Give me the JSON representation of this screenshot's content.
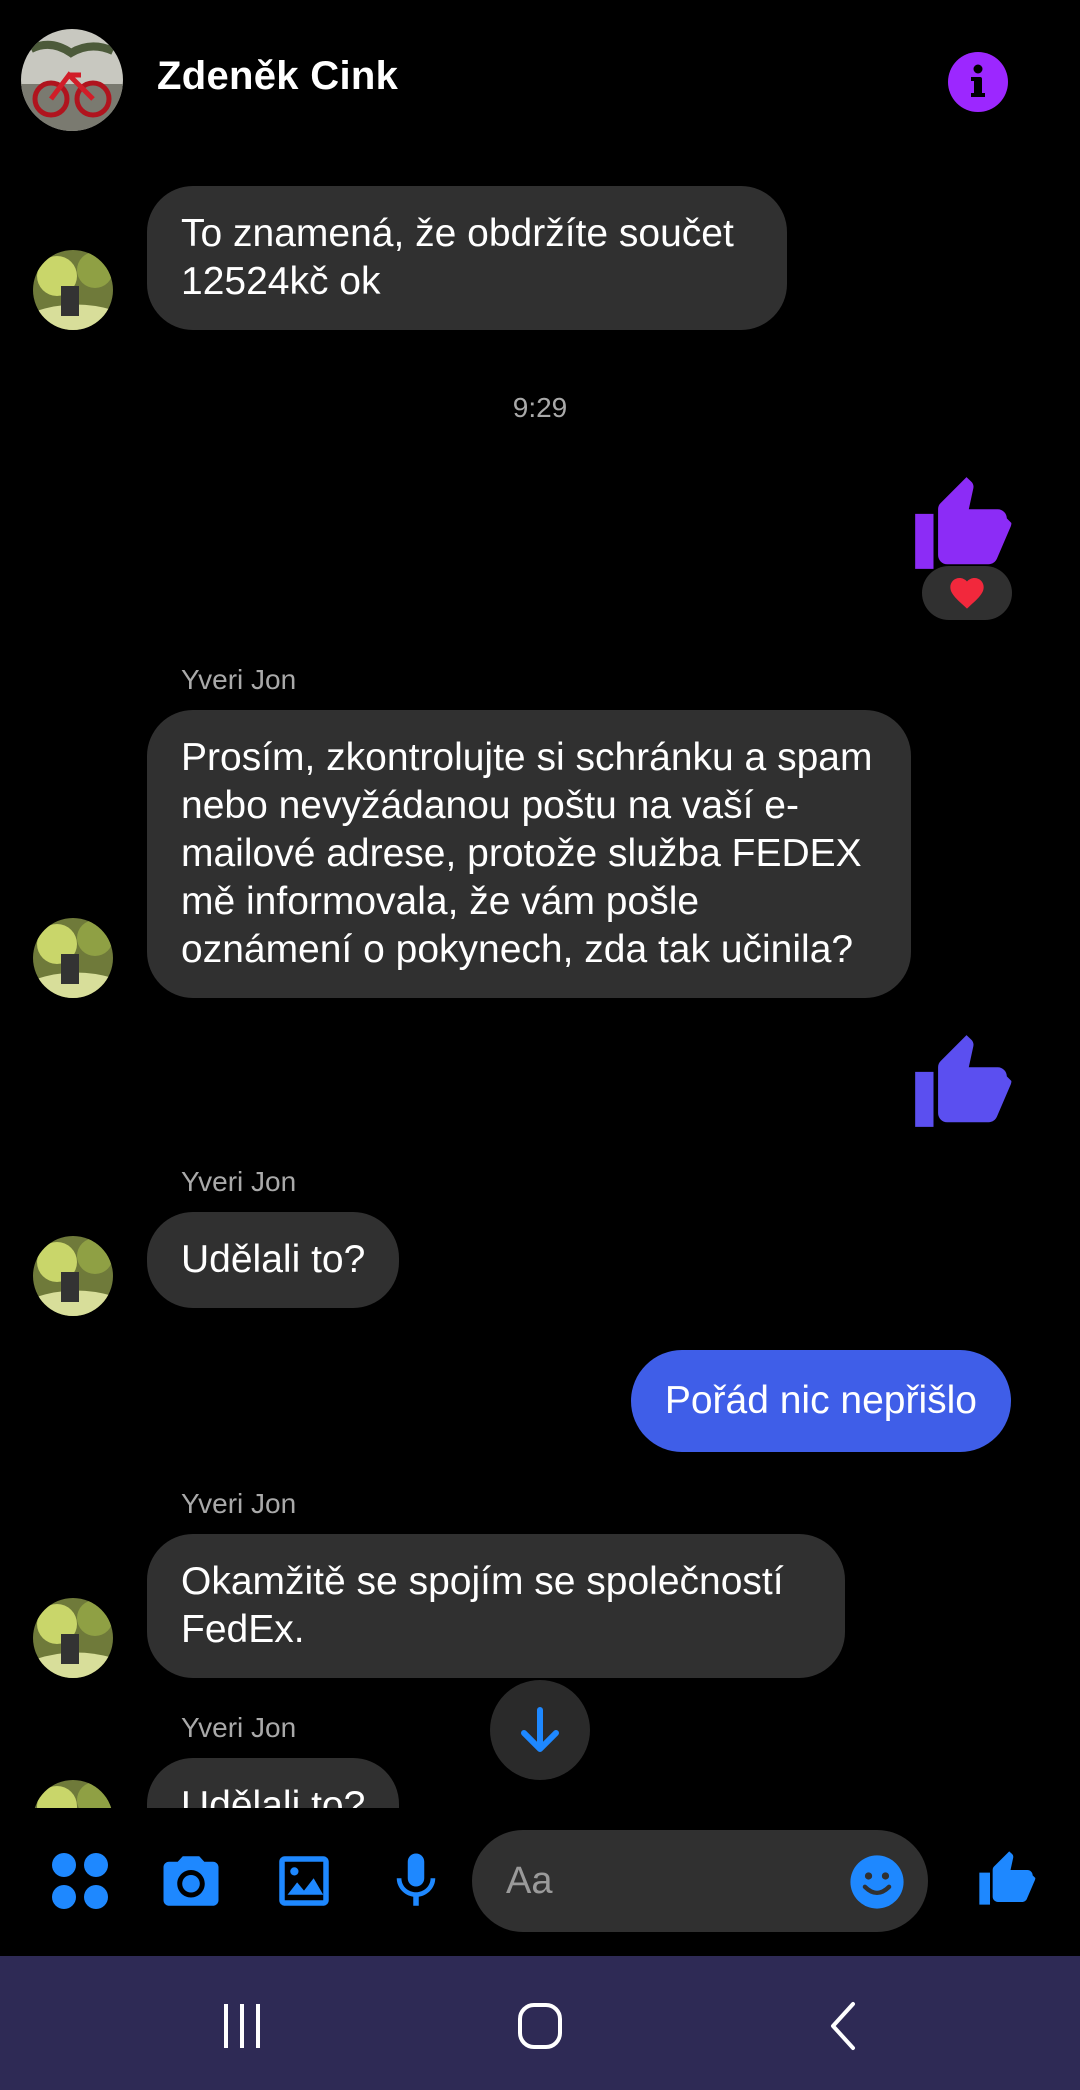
{
  "header": {
    "contact_name": "Zdeněk Cink",
    "accent_color": "#9c27ff"
  },
  "conversation": {
    "messages": [
      {
        "type": "incoming",
        "text": "To znamená, že obdržíte součet 12524kč ok"
      },
      {
        "type": "timestamp",
        "text": "9:29"
      },
      {
        "type": "outgoing-like",
        "color": "#8c2cf6",
        "reaction": "❤️"
      },
      {
        "type": "incoming",
        "sender": "Yveri Jon",
        "text": "Prosím, zkontrolujte si schránku a spam nebo nevyžádanou poštu na vaší e-mailové adrese, protože služba FEDEX mě informovala, že vám pošle oznámení o pokynech, zda tak učinila?"
      },
      {
        "type": "outgoing-like",
        "color": "#5b4ff0"
      },
      {
        "type": "incoming",
        "sender": "Yveri Jon",
        "text": "Udělali to?"
      },
      {
        "type": "outgoing",
        "text": "Pořád nic nepřišlo"
      },
      {
        "type": "incoming",
        "sender": "Yveri Jon",
        "text": "Okamžitě se spojím se společností FedEx."
      },
      {
        "type": "incoming",
        "sender": "Yveri Jon",
        "text": "Udělali to?"
      }
    ]
  },
  "composer": {
    "placeholder": "Aa",
    "accent_color": "#1e88ff",
    "icons": [
      "apps-icon",
      "camera-icon",
      "gallery-icon",
      "microphone-icon",
      "emoji-icon",
      "thumbs-up-icon"
    ]
  },
  "colors": {
    "background": "#000000",
    "incoming_bubble": "#303030",
    "outgoing_bubble": "#3f5ee8",
    "nav_bar": "#2e2a55"
  }
}
